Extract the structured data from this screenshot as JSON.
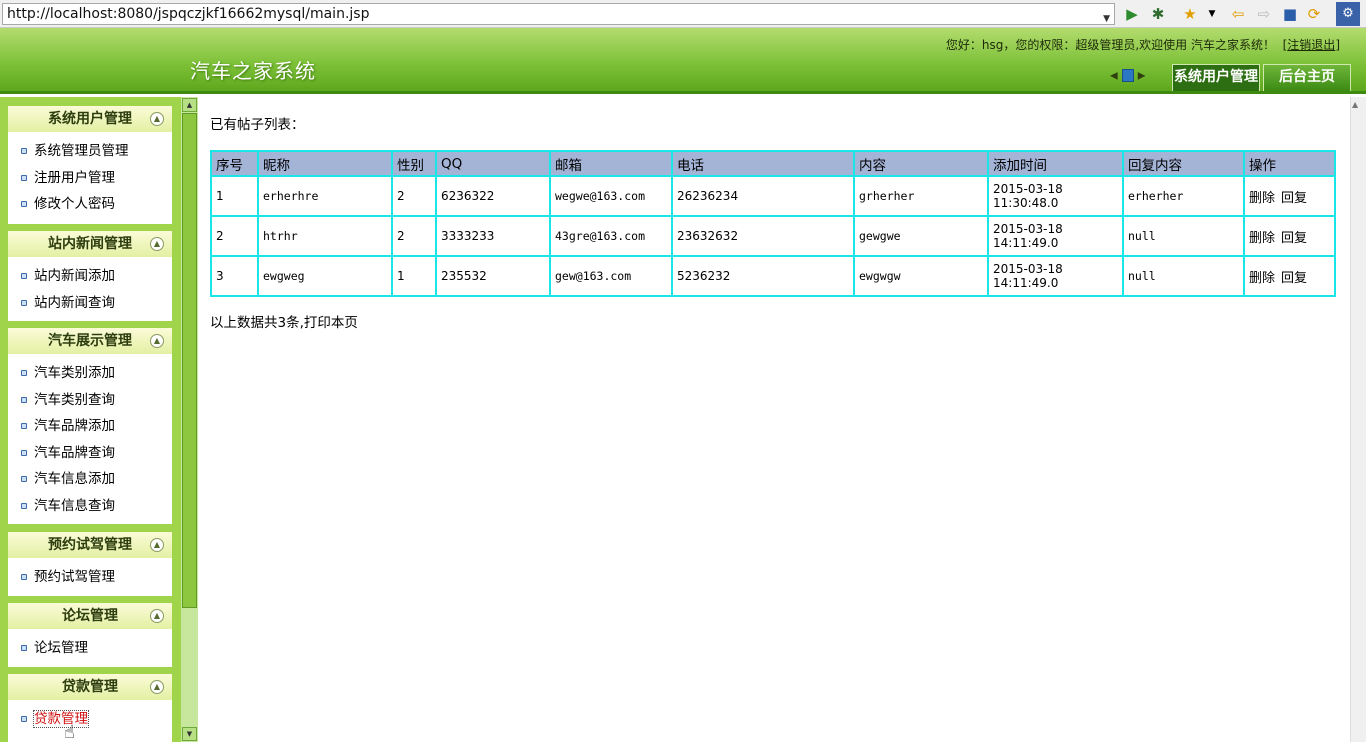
{
  "browser": {
    "url": "http://localhost:8080/jspqczjkf16662mysql/main.jsp"
  },
  "header": {
    "app_title": "汽车之家系统",
    "greeting": "您好：hsg，您的权限：超级管理员,欢迎使用 汽车之家系统！",
    "logout": "注销退出",
    "tabs": [
      "系统用户管理",
      "后台主页"
    ]
  },
  "sidebar": {
    "sections": [
      {
        "title": "系统用户管理",
        "items": [
          "系统管理员管理",
          "注册用户管理",
          "修改个人密码"
        ]
      },
      {
        "title": "站内新闻管理",
        "items": [
          "站内新闻添加",
          "站内新闻查询"
        ]
      },
      {
        "title": "汽车展示管理",
        "items": [
          "汽车类别添加",
          "汽车类别查询",
          "汽车品牌添加",
          "汽车品牌查询",
          "汽车信息添加",
          "汽车信息查询"
        ]
      },
      {
        "title": "预约试驾管理",
        "items": [
          "预约试驾管理"
        ]
      },
      {
        "title": "论坛管理",
        "items": [
          "论坛管理"
        ]
      },
      {
        "title": "贷款管理",
        "items": [
          "贷款管理"
        ]
      }
    ],
    "active_item": "贷款管理"
  },
  "main": {
    "list_title": "已有帖子列表：",
    "columns": [
      "序号",
      "昵称",
      "性别",
      "QQ",
      "邮箱",
      "电话",
      "内容",
      "添加时间",
      "回复内容",
      "操作"
    ],
    "rows": [
      {
        "no": "1",
        "nick": "erherhre",
        "gender": "2",
        "qq": "6236322",
        "email": "wegwe@163.com",
        "phone": "26236234",
        "content": "grherher",
        "date": "2015-03-18",
        "time": "11:30:48.0",
        "reply": "erherher"
      },
      {
        "no": "2",
        "nick": "htrhr",
        "gender": "2",
        "qq": "3333233",
        "email": "43gre@163.com",
        "phone": "23632632",
        "content": "gewgwe",
        "date": "2015-03-18",
        "time": "14:11:49.0",
        "reply": "null"
      },
      {
        "no": "3",
        "nick": "ewgweg",
        "gender": "1",
        "qq": "235532",
        "email": "gew@163.com",
        "phone": "5236232",
        "content": "ewgwgw",
        "date": "2015-03-18",
        "time": "14:11:49.0",
        "reply": "null"
      }
    ],
    "actions": {
      "delete": "删除",
      "reply": "回复"
    },
    "summary_prefix": "以上数据共3条,",
    "print_link": "打印本页"
  }
}
